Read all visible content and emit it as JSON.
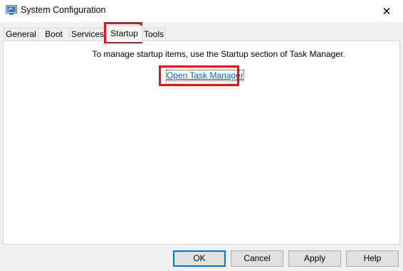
{
  "window": {
    "title": "System Configuration",
    "icon": "msconfig-icon",
    "close_glyph": "✕"
  },
  "tabs": [
    {
      "label": "General"
    },
    {
      "label": "Boot"
    },
    {
      "label": "Services"
    },
    {
      "label": "Startup",
      "active": true
    },
    {
      "label": "Tools"
    }
  ],
  "startup_panel": {
    "message": "To manage startup items, use the Startup section of Task Manager.",
    "link_label": "Open Task Manager"
  },
  "buttons": {
    "ok": "OK",
    "cancel": "Cancel",
    "apply": "Apply",
    "help": "Help"
  },
  "colors": {
    "highlight": "#e0131e",
    "link": "#0066cc",
    "default_button_border": "#0078d7"
  }
}
